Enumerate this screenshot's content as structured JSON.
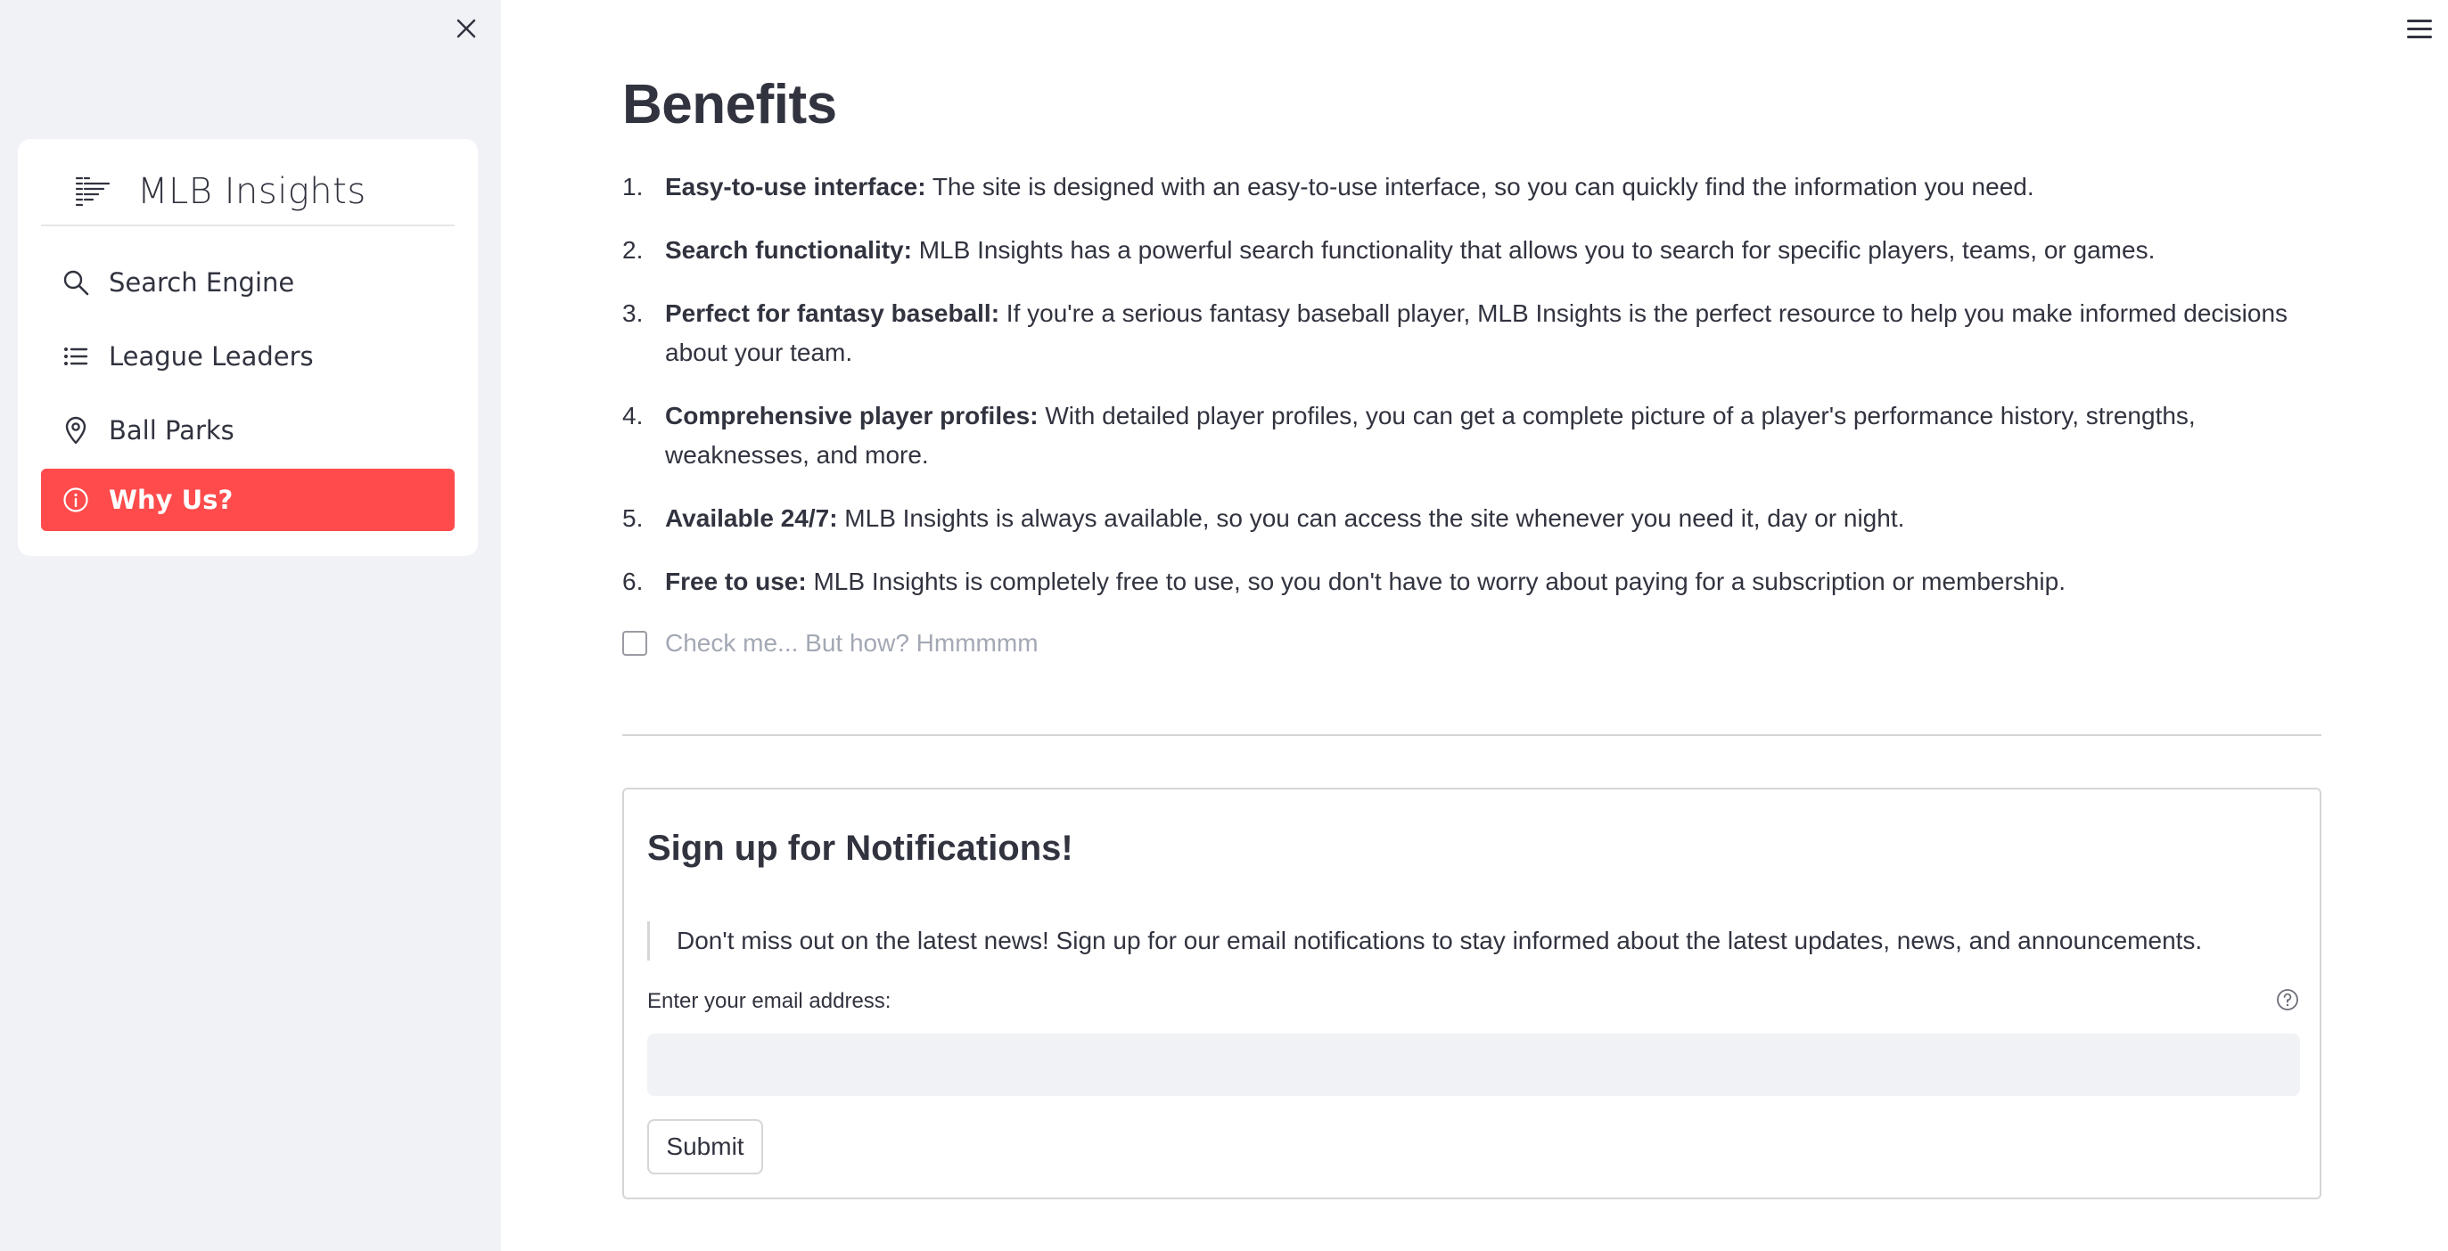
{
  "sidebar": {
    "brand": {
      "title": "MLB Insights",
      "icon": "streamlit-logo-icon"
    },
    "items": [
      {
        "label": "Search Engine",
        "icon": "search-icon",
        "active": false
      },
      {
        "label": "League Leaders",
        "icon": "list-icon",
        "active": false
      },
      {
        "label": "Ball Parks",
        "icon": "map-pin-icon",
        "active": false
      },
      {
        "label": "Why Us?",
        "icon": "info-icon",
        "active": true
      }
    ],
    "close_icon": "close-icon"
  },
  "header": {
    "menu_icon": "hamburger-menu-icon"
  },
  "main": {
    "title": "Benefits",
    "benefits": [
      {
        "num": "1.",
        "bold": "Easy-to-use interface:",
        "text": " The site is designed with an easy-to-use interface, so you can quickly find the information you need."
      },
      {
        "num": "2.",
        "bold": "Search functionality:",
        "text": " MLB Insights has a powerful search functionality that allows you to search for specific players, teams, or games."
      },
      {
        "num": "3.",
        "bold": "Perfect for fantasy baseball:",
        "text": " If you're a serious fantasy baseball player, MLB Insights is the perfect resource to help you make informed decisions about your team."
      },
      {
        "num": "4.",
        "bold": "Comprehensive player profiles:",
        "text": " With detailed player profiles, you can get a complete picture of a player's performance history, strengths, weaknesses, and more."
      },
      {
        "num": "5.",
        "bold": "Available 24/7:",
        "text": " MLB Insights is always available, so you can access the site whenever you need it, day or night."
      },
      {
        "num": "6.",
        "bold": "Free to use:",
        "text": " MLB Insights is completely free to use, so you don't have to worry about paying for a subscription or membership."
      }
    ],
    "checkbox": {
      "label": "Check me... But how? Hmmmmm",
      "checked": false
    }
  },
  "signup": {
    "title": "Sign up for Notifications!",
    "description": "Don't miss out on the latest news! Sign up for our email notifications to stay informed about the latest updates, news, and announcements.",
    "email_label": "Enter your email address:",
    "email_value": "",
    "help_icon": "question-circle-icon",
    "submit_label": "Submit"
  },
  "colors": {
    "accent": "#ff4b4b",
    "sidebar_bg": "#f0f2f6",
    "text": "#31333f",
    "muted": "#a3a8b4"
  }
}
